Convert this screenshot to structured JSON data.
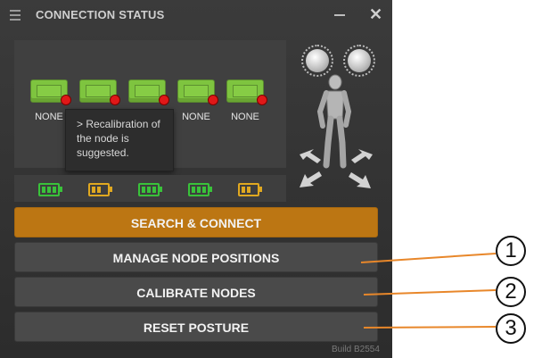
{
  "window": {
    "title": "CONNECTION STATUS",
    "menu_icon": "hamburger-icon",
    "minimize_icon": "minimize-icon",
    "close_icon": "close-icon",
    "close_glyph": "✕"
  },
  "nodes": [
    {
      "label": "NONE",
      "status": "disconnected"
    },
    {
      "label": "",
      "status": "disconnected"
    },
    {
      "label": "",
      "status": "disconnected"
    },
    {
      "label": "NONE",
      "status": "disconnected"
    },
    {
      "label": "NONE",
      "status": "disconnected"
    }
  ],
  "tooltip": {
    "text": "> Recalibration of the node is suggested."
  },
  "batteries": [
    {
      "level": 1.0,
      "color": "#39c23a"
    },
    {
      "level": 0.66,
      "color": "#e0a820"
    },
    {
      "level": 1.0,
      "color": "#39c23a"
    },
    {
      "level": 1.0,
      "color": "#39c23a"
    },
    {
      "level": 0.66,
      "color": "#e0a820"
    }
  ],
  "buttons": {
    "search_connect": "SEARCH & CONNECT",
    "manage_positions": "MANAGE NODE POSITIONS",
    "calibrate": "CALIBRATE NODES",
    "reset_posture": "RESET POSTURE"
  },
  "build": "Build B2554",
  "callouts": [
    "1",
    "2",
    "3"
  ],
  "colors": {
    "accent": "#bc7613",
    "callout_line": "#e8872a",
    "node_green": "#7ec43f",
    "node_alert": "#e01818"
  }
}
